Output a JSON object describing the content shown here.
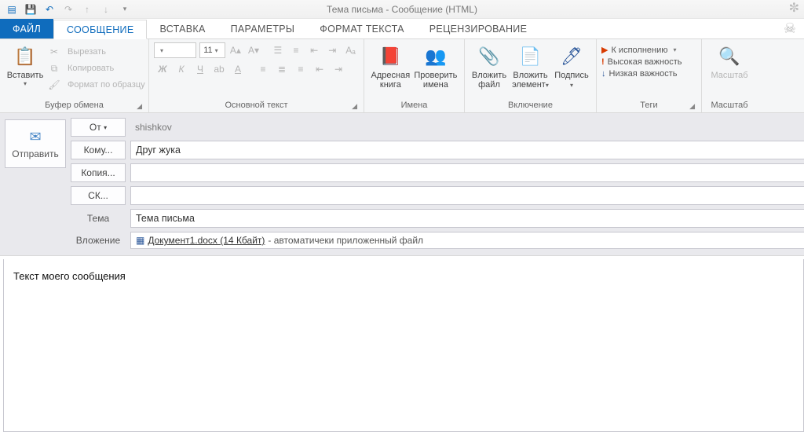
{
  "window": {
    "title": "Тема письма - Сообщение (HTML)"
  },
  "qat": {
    "save": "💾",
    "undo": "↶",
    "redo": "↷"
  },
  "tabs": {
    "file": "ФАЙЛ",
    "message": "СООБЩЕНИЕ",
    "insert": "ВСТАВКА",
    "options": "ПАРАМЕТРЫ",
    "format": "ФОРМАТ ТЕКСТА",
    "review": "РЕЦЕНЗИРОВАНИЕ"
  },
  "ribbon": {
    "clipboard": {
      "label": "Буфер обмена",
      "paste": "Вставить",
      "cut": "Вырезать",
      "copy": "Копировать",
      "format_painter": "Формат по образцу"
    },
    "font": {
      "label": "Основной текст",
      "size": "11"
    },
    "names": {
      "label": "Имена",
      "address_book": "Адресная книга",
      "check_names": "Проверить имена"
    },
    "include": {
      "label": "Включение",
      "attach_file": "Вложить файл",
      "attach_item": "Вложить элемент",
      "signature": "Подпись"
    },
    "tags": {
      "label": "Теги",
      "follow_up": "К исполнению",
      "high_importance": "Высокая важность",
      "low_importance": "Низкая важность"
    },
    "zoom": {
      "label": "Масштаб",
      "btn": "Масштаб"
    }
  },
  "compose": {
    "send": "Отправить",
    "from_label": "От",
    "from_value": "shishkov",
    "to_label": "Кому...",
    "to_value": "Друг жука",
    "cc_label": "Копия...",
    "cc_value": "",
    "bcc_label": "СК...",
    "bcc_value": "",
    "subject_label": "Тема",
    "subject_value": "Тема письма",
    "attach_label": "Вложение",
    "attach_name": "Документ1.docx (14 Кбайт)",
    "attach_note": " - автоматичеки приложенный файл"
  },
  "body": {
    "text": "Текст моего сообщения"
  }
}
